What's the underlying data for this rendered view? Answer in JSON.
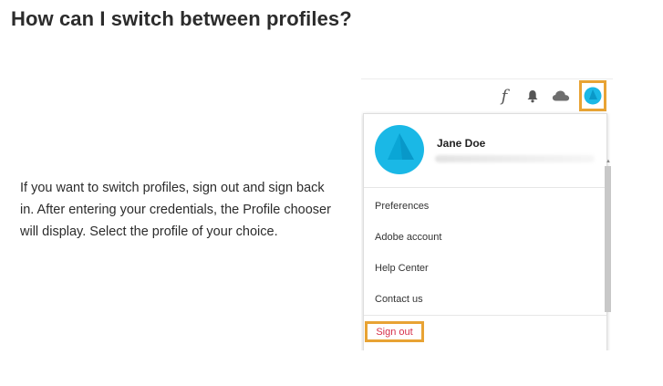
{
  "heading": "How can I switch between profiles?",
  "body": "If you want to switch profiles, sign out and sign back in. After entering your credentials, the Profile chooser will display. Select the profile of your choice.",
  "illustration": {
    "toolbar": {
      "fonts_glyph": "f",
      "icons": [
        "fonts-icon",
        "bell-icon",
        "cloud-icon",
        "avatar-icon"
      ]
    },
    "profile": {
      "name": "Jane Doe"
    },
    "menu_items": [
      "Preferences",
      "Adobe account",
      "Help Center",
      "Contact us"
    ],
    "sign_out": "Sign out",
    "colors": {
      "highlight": "#e8a334",
      "avatar_blue": "#1ab8e6",
      "sign_out_red": "#d6304a"
    }
  }
}
